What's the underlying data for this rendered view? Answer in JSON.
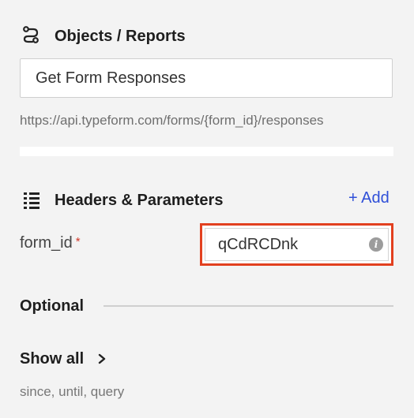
{
  "objects": {
    "title": "Objects / Reports",
    "icon": "route-icon",
    "selected_object": "Get Form Responses",
    "endpoint_url": "https://api.typeform.com/forms/{form_id}/responses"
  },
  "parameters": {
    "title": "Headers & Parameters",
    "icon": "list-icon",
    "add_label": "+ Add",
    "fields": [
      {
        "name": "form_id",
        "required_marker": "*",
        "value": "qCdRCDnk"
      }
    ]
  },
  "optional": {
    "label": "Optional",
    "show_all_label": "Show all",
    "params_summary": "since, until, query"
  },
  "colors": {
    "accent": "#2f4fd8",
    "highlight": "#e2401f",
    "required": "#d23a2a"
  }
}
